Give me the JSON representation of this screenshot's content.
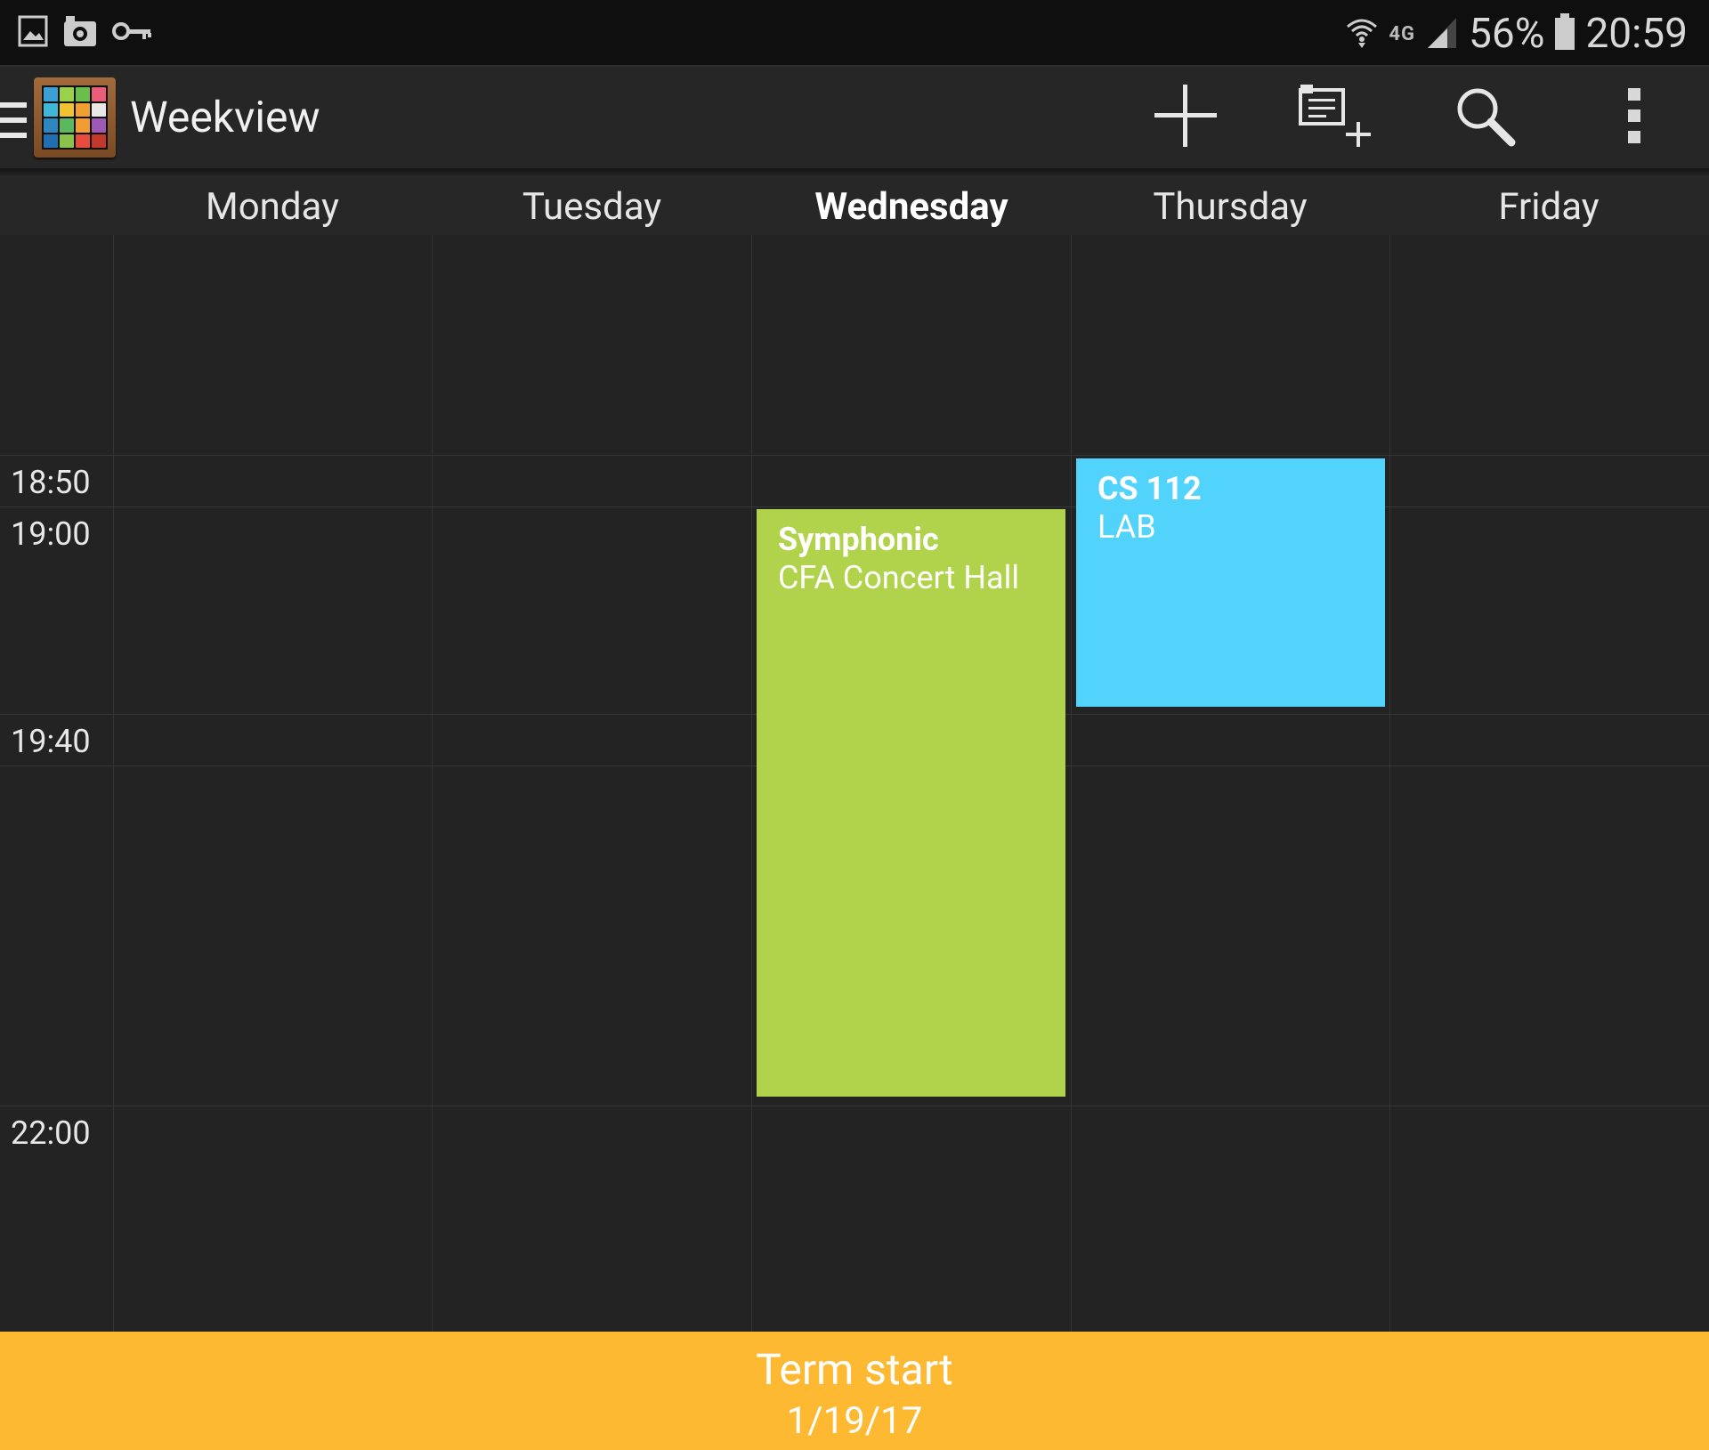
{
  "status_bar": {
    "notification_icons": [
      "gallery-icon",
      "camera-notification-icon",
      "key-icon"
    ],
    "network": "4G",
    "battery": "56%",
    "time": "20:59"
  },
  "app_bar": {
    "title": "Weekview",
    "actions": [
      "add-icon",
      "add-multiple-icon",
      "search-icon",
      "overflow-menu-icon"
    ]
  },
  "days": [
    {
      "label": "Monday",
      "today": false
    },
    {
      "label": "Tuesday",
      "today": false
    },
    {
      "label": "Wednesday",
      "today": true
    },
    {
      "label": "Thursday",
      "today": false
    },
    {
      "label": "Friday",
      "today": false
    }
  ],
  "time_slots": [
    "18:50",
    "19:00",
    "19:40",
    "22:00"
  ],
  "events": [
    {
      "title": "Symphonic",
      "subtitle": "CFA Concert Hall",
      "day": "Wednesday",
      "color": "#b1d34c"
    },
    {
      "title": "CS 112",
      "subtitle": "LAB",
      "day": "Thursday",
      "color": "#51d3fc"
    }
  ],
  "footer": {
    "title": "Term start",
    "date": "1/19/17",
    "color": "#fdb931"
  }
}
